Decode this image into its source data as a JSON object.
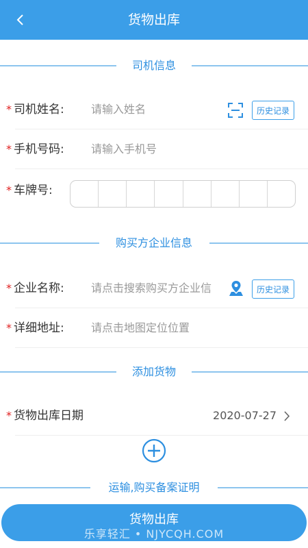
{
  "header": {
    "title": "货物出库",
    "back_icon": "chevron-left-icon"
  },
  "sections": {
    "driver": "司机信息",
    "buyer": "购买方企业信息",
    "goods": "添加货物",
    "certificate": "运输,购买备案证明"
  },
  "driver_name": {
    "required": "*",
    "label": "司机姓名:",
    "placeholder": "请输入姓名",
    "history_label": "历史记录",
    "scan_icon": "scan-icon"
  },
  "phone": {
    "required": "*",
    "label": "手机号码:",
    "placeholder": "请输入手机号"
  },
  "plate": {
    "required": "*",
    "label": "车牌号:",
    "cells": 8
  },
  "company": {
    "required": "*",
    "label": "企业名称:",
    "placeholder": "请点击搜索购买方企业信",
    "history_label": "历史记录",
    "location_icon": "person-location-icon"
  },
  "address": {
    "required": "*",
    "label": "详细地址:",
    "placeholder": "请点击地图定位位置"
  },
  "date": {
    "required": "*",
    "label": "货物出库日期",
    "value": "2020-07-27"
  },
  "add_icon": "plus-circle-icon",
  "submit": {
    "label": "货物出库"
  },
  "watermark": "乐享轻汇 • NJYCQH.COM",
  "colors": {
    "primary": "#3b9ee8",
    "required": "#e02020",
    "placeholder": "#999999"
  }
}
